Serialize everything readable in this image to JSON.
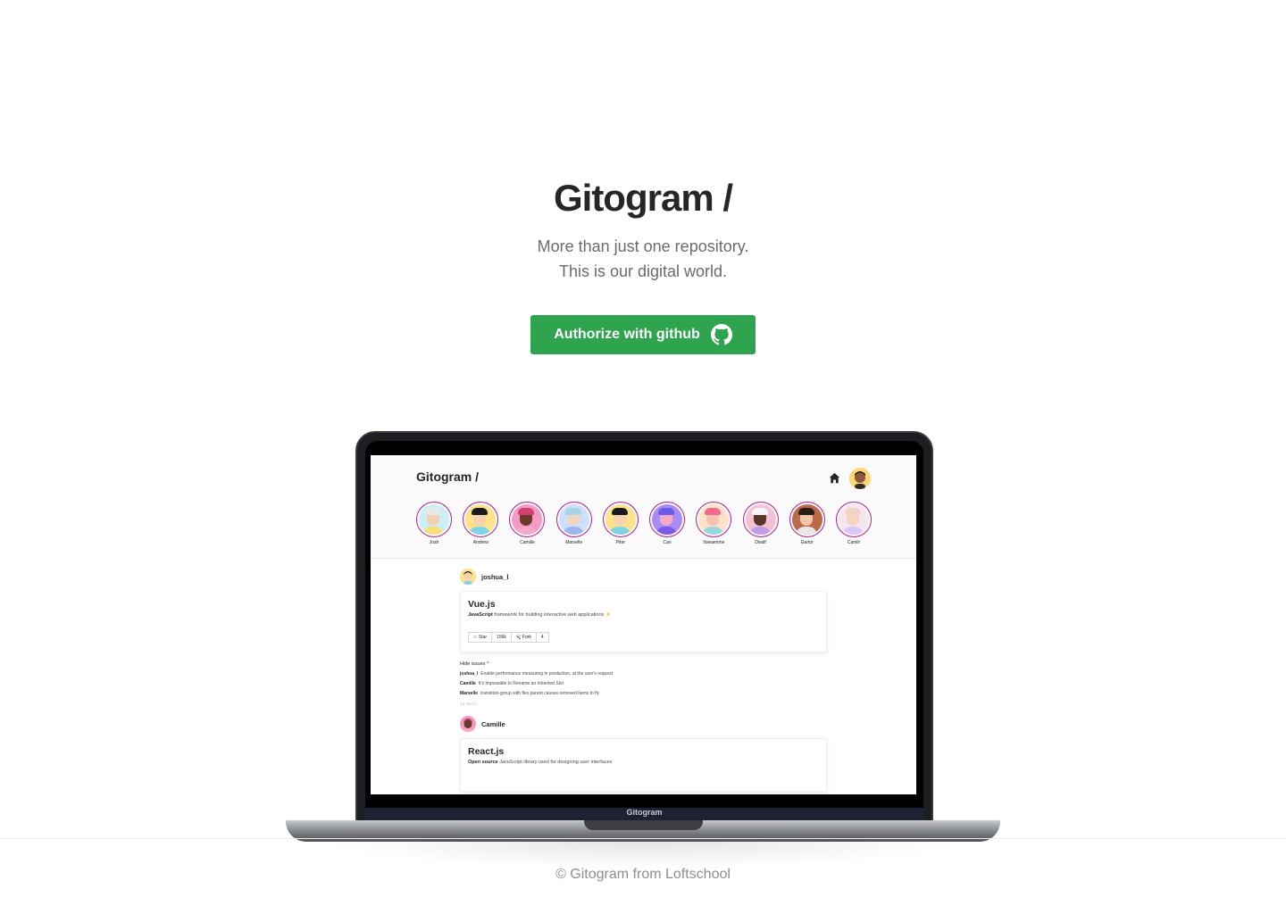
{
  "hero": {
    "title": "Gitogram /",
    "subtitle_line1": "More than just one repository.",
    "subtitle_line2": "This is our digital world.",
    "auth_button_label": "Authorize with github",
    "auth_button_color": "#2ea44f",
    "auth_button_icon": "github-icon"
  },
  "laptop": {
    "chin_label": "Gitogram",
    "app": {
      "logo": "Gitogram /",
      "header_icons": [
        "home-icon",
        "user-avatar"
      ],
      "stories": [
        {
          "name": "Josh",
          "bg": "#cdeff4",
          "skin": "#f1d2b6",
          "hair": "#e8e8e8",
          "shirt": "#f7e07a"
        },
        {
          "name": "Andrew",
          "bg": "#ffe38a",
          "skin": "#f6d2b0",
          "hair": "#1a1a1a",
          "shirt": "#7fd3e6"
        },
        {
          "name": "Camille",
          "bg": "#f59ac4",
          "skin": "#6b3b2a",
          "hair": "#d1406e",
          "shirt": "#f6a8c8"
        },
        {
          "name": "Marselle",
          "bg": "#cfe0ff",
          "skin": "#f3d6c0",
          "hair": "#a8d4e8",
          "shirt": "#9cb5ef"
        },
        {
          "name": "Piter",
          "bg": "#ffe38a",
          "skin": "#f6d2b0",
          "hair": "#1a1a1a",
          "shirt": "#7fd3e6"
        },
        {
          "name": "Can",
          "bg": "#a88cf5",
          "skin": "#f4a9c4",
          "hair": "#6b5ce8",
          "shirt": "#7c5ce6"
        },
        {
          "name": "Ilowaenme",
          "bg": "#ffe2c8",
          "skin": "#f7c2b0",
          "hair": "#f06b8c",
          "shirt": "#94d8e0"
        },
        {
          "name": "Disalf",
          "bg": "#f3c1d4",
          "skin": "#5a3425",
          "hair": "#f5f5f5",
          "shirt": "#c39be8"
        },
        {
          "name": "Gartor",
          "bg": "#b96a4a",
          "skin": "#f1c6a6",
          "hair": "#2a1c18",
          "shirt": "#e8e8e8"
        },
        {
          "name": "Camilr",
          "bg": "#f7e6ef",
          "skin": "#f6d4c2",
          "hair": "#f1d4c8",
          "shirt": "#d9c6f5"
        }
      ],
      "posts": [
        {
          "user": "joshua_l",
          "repo_title": "Vue.js",
          "repo_lang": "JavaScript",
          "repo_desc": "framework for building interactive web applications ⚡",
          "star_label": "☆ Star",
          "star_count": "156k",
          "fork_label": "Fork",
          "fork_count": "4",
          "issues_toggle": "Hide issues ^",
          "issues": [
            {
              "user": "joshua_l",
              "text": "Enable performance measuring in production, at the user's request"
            },
            {
              "user": "Camille",
              "text": "It's Impossible to Rename an Inherited Slot"
            },
            {
              "user": "Marselle",
              "text": "transition-group with flex parent causes removed items to fly"
            }
          ],
          "date": "15 MAY"
        },
        {
          "user": "Camille",
          "repo_title": "React.js",
          "repo_lang": "Open source",
          "repo_desc": "JavaScript library used for designing user interfaces"
        }
      ]
    }
  },
  "footer": {
    "text": "© Gitogram from Loftschool"
  }
}
